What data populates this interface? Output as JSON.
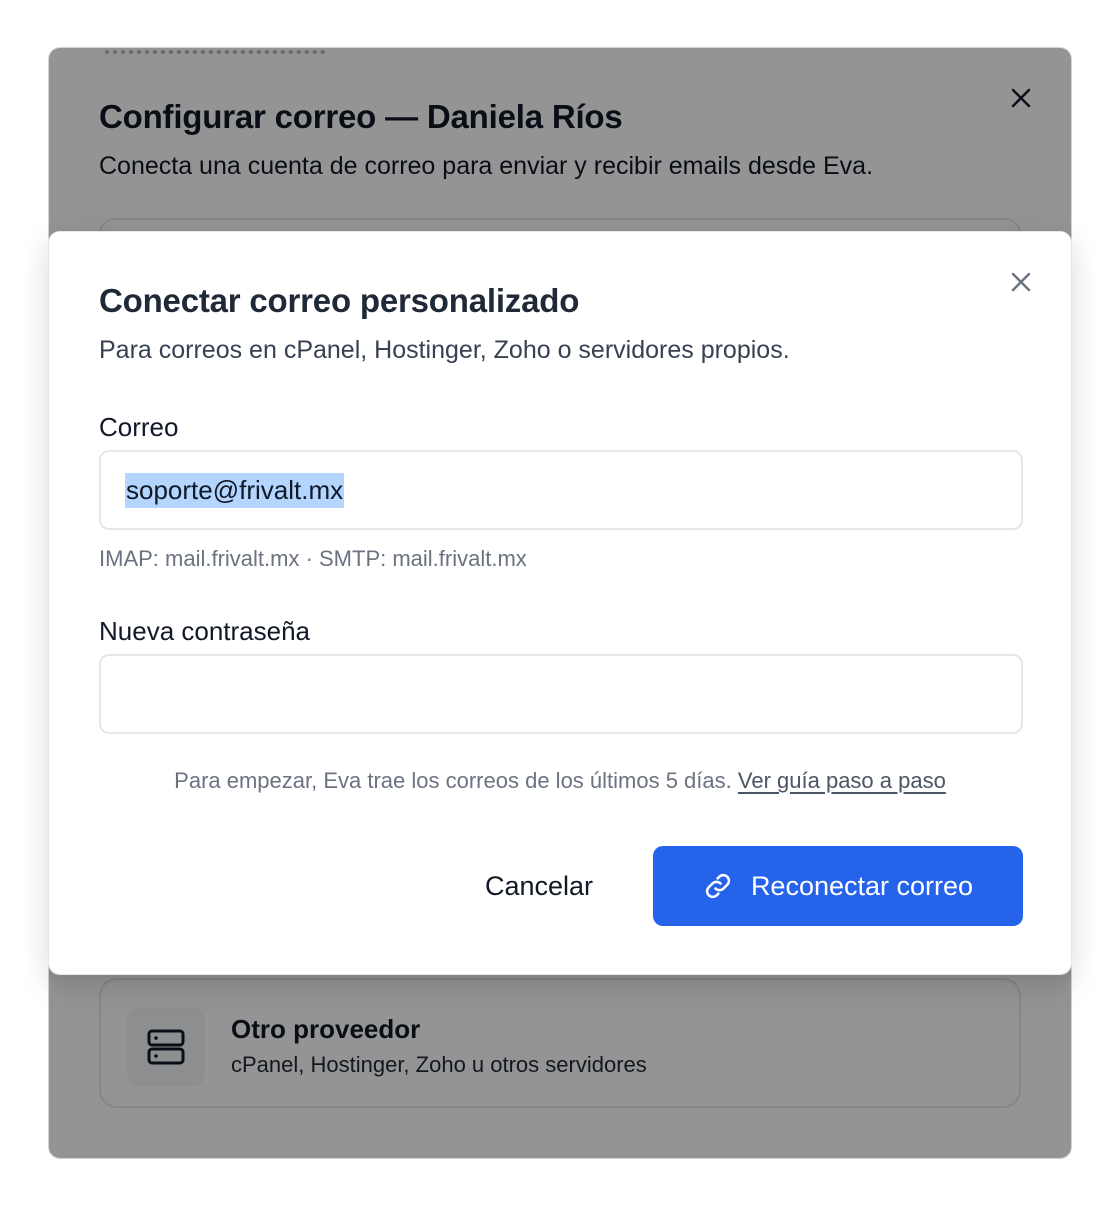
{
  "parent_dialog": {
    "title": "Configurar correo — Daniela Ríos",
    "subtitle": "Conecta una cuenta de correo para enviar y recibir emails desde Eva.",
    "close_icon": "close-icon",
    "other_provider": {
      "name": "Otro proveedor",
      "description": "cPanel, Hostinger, Zoho u otros servidores",
      "icon": "server-icon"
    }
  },
  "child_dialog": {
    "title": "Conectar correo personalizado",
    "subtitle": "Para correos en cPanel, Hostinger, Zoho o servidores propios.",
    "close_icon": "close-icon",
    "email": {
      "label": "Correo",
      "value": "soporte@frivalt.mx",
      "server_hint": "IMAP: mail.frivalt.mx · SMTP: mail.frivalt.mx"
    },
    "password": {
      "label": "Nueva contraseña",
      "value": ""
    },
    "info": {
      "text": "Para empezar, Eva trae los correos de los últimos 5 días.",
      "link": "Ver guía paso a paso"
    },
    "buttons": {
      "cancel": "Cancelar",
      "reconnect": "Reconectar correo",
      "reconnect_icon": "link-icon"
    }
  },
  "colors": {
    "primary": "#2563eb",
    "overlay": "rgba(0,0,0,0.42)",
    "selection": "#b4d5fe"
  }
}
